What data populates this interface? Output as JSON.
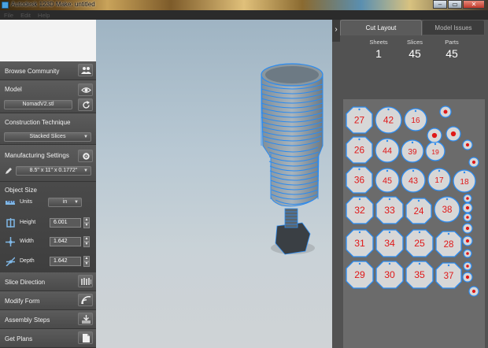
{
  "window": {
    "title": "Autodesk 123D Make: untitled"
  },
  "menu": {
    "items": [
      "File",
      "Edit",
      "Help"
    ]
  },
  "left_panel": {
    "browse_community": "Browse Community",
    "model_label": "Model",
    "model_file": "NomadV2.stl",
    "construction_label": "Construction Technique",
    "construction_value": "Stacked Slices",
    "manufacturing_label": "Manufacturing Settings",
    "manufacturing_value": "8.5\" x 11\" x 0.1772\"",
    "object_size": {
      "label": "Object Size",
      "units_label": "Units",
      "units_value": "in",
      "height_label": "Height",
      "height_value": "6.001",
      "width_label": "Width",
      "width_value": "1.642",
      "depth_label": "Depth",
      "depth_value": "1.642"
    },
    "slice_direction": "Slice Direction",
    "modify_form": "Modify Form",
    "assembly_steps": "Assembly Steps",
    "get_plans": "Get Plans"
  },
  "right_panel": {
    "tabs": [
      "Cut Layout",
      "Model Issues"
    ],
    "stats": [
      {
        "label": "Sheets",
        "value": "1"
      },
      {
        "label": "Slices",
        "value": "45"
      },
      {
        "label": "Parts",
        "value": "45"
      }
    ],
    "part_numbers": [
      "27",
      "42",
      "16",
      "26",
      "44",
      "39",
      "19",
      "36",
      "45",
      "43",
      "17",
      "18",
      "32",
      "33",
      "24",
      "38",
      "31",
      "34",
      "25",
      "28",
      "29",
      "30",
      "35",
      "37"
    ]
  },
  "colors": {
    "accent_blue": "#2b8bf0",
    "part_label_red": "#e01818",
    "panel_dark": "#4a4a4a"
  }
}
